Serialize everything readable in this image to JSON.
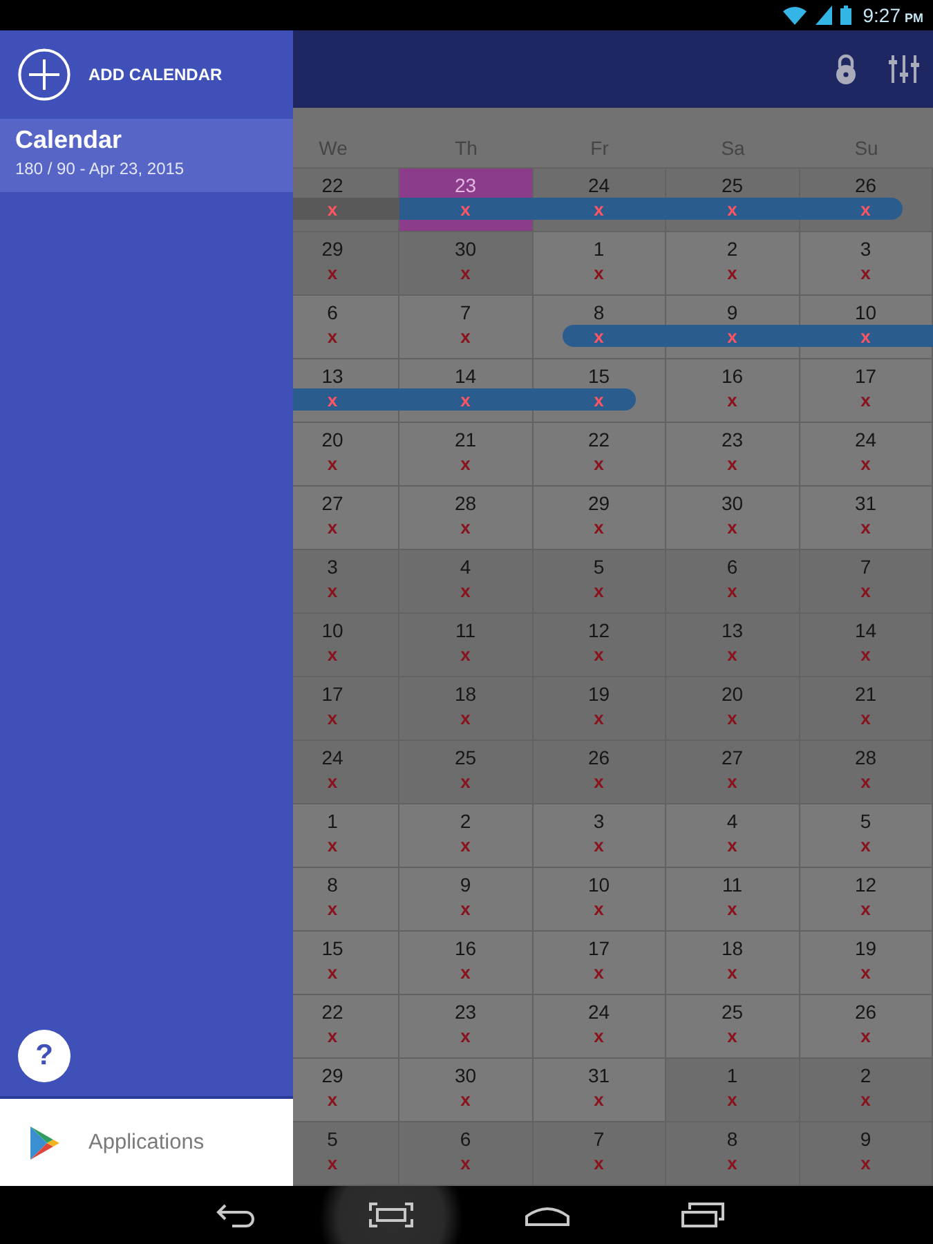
{
  "status_bar": {
    "time": "9:27",
    "meridiem": "PM"
  },
  "drawer": {
    "add_label": "ADD CALENDAR",
    "items": [
      {
        "title": "Calendar",
        "subtitle": "180 / 90 - Apr 23, 2015",
        "selected": true
      }
    ],
    "help_label": "?",
    "footer_label": "Applications"
  },
  "calendar": {
    "weekdays": [
      "We",
      "Th",
      "Fr",
      "Sa",
      "Su"
    ],
    "weeks": [
      [
        {
          "day": "22",
          "mark": "x",
          "shaded": true,
          "today": false,
          "band": {
            "starts": false,
            "ends": false,
            "color": "#595959"
          }
        },
        {
          "day": "23",
          "mark": "x",
          "shaded": true,
          "today": true,
          "band": {
            "starts": false,
            "ends": false,
            "color": "#2b5c8e"
          }
        },
        {
          "day": "24",
          "mark": "x",
          "shaded": true,
          "today": false,
          "band": {
            "starts": false,
            "ends": false,
            "color": "#2b5c8e"
          }
        },
        {
          "day": "25",
          "mark": "x",
          "shaded": true,
          "today": false,
          "band": {
            "starts": false,
            "ends": false,
            "color": "#2b5c8e"
          }
        },
        {
          "day": "26",
          "mark": "x",
          "shaded": true,
          "today": false,
          "band": {
            "starts": false,
            "ends": true,
            "color": "#2b5c8e"
          }
        }
      ],
      [
        {
          "day": "29",
          "mark": "x",
          "shaded": true,
          "today": false
        },
        {
          "day": "30",
          "mark": "x",
          "shaded": true,
          "today": false
        },
        {
          "day": "1",
          "mark": "x",
          "shaded": false,
          "today": false
        },
        {
          "day": "2",
          "mark": "x",
          "shaded": false,
          "today": false
        },
        {
          "day": "3",
          "mark": "x",
          "shaded": false,
          "today": false
        }
      ],
      [
        {
          "day": "6",
          "mark": "x",
          "shaded": false,
          "today": false
        },
        {
          "day": "7",
          "mark": "x",
          "shaded": false,
          "today": false
        },
        {
          "day": "8",
          "mark": "x",
          "shaded": false,
          "today": false,
          "band": {
            "starts": true,
            "ends": false,
            "color": "#2b5c8e"
          }
        },
        {
          "day": "9",
          "mark": "x",
          "shaded": false,
          "today": false,
          "band": {
            "starts": false,
            "ends": false,
            "color": "#2b5c8e"
          }
        },
        {
          "day": "10",
          "mark": "x",
          "shaded": false,
          "today": false,
          "band": {
            "starts": false,
            "ends": false,
            "color": "#2b5c8e"
          }
        }
      ],
      [
        {
          "day": "13",
          "mark": "x",
          "shaded": false,
          "today": false,
          "band": {
            "starts": false,
            "ends": false,
            "color": "#2b5c8e"
          }
        },
        {
          "day": "14",
          "mark": "x",
          "shaded": false,
          "today": false,
          "band": {
            "starts": false,
            "ends": false,
            "color": "#2b5c8e"
          }
        },
        {
          "day": "15",
          "mark": "x",
          "shaded": false,
          "today": false,
          "band": {
            "starts": false,
            "ends": true,
            "color": "#2b5c8e"
          }
        },
        {
          "day": "16",
          "mark": "x",
          "shaded": false,
          "today": false
        },
        {
          "day": "17",
          "mark": "x",
          "shaded": false,
          "today": false
        }
      ],
      [
        {
          "day": "20",
          "mark": "x",
          "shaded": false,
          "today": false
        },
        {
          "day": "21",
          "mark": "x",
          "shaded": false,
          "today": false
        },
        {
          "day": "22",
          "mark": "x",
          "shaded": false,
          "today": false
        },
        {
          "day": "23",
          "mark": "x",
          "shaded": false,
          "today": false
        },
        {
          "day": "24",
          "mark": "x",
          "shaded": false,
          "today": false
        }
      ],
      [
        {
          "day": "27",
          "mark": "x",
          "shaded": false,
          "today": false
        },
        {
          "day": "28",
          "mark": "x",
          "shaded": false,
          "today": false
        },
        {
          "day": "29",
          "mark": "x",
          "shaded": false,
          "today": false
        },
        {
          "day": "30",
          "mark": "x",
          "shaded": false,
          "today": false
        },
        {
          "day": "31",
          "mark": "x",
          "shaded": false,
          "today": false
        }
      ],
      [
        {
          "day": "3",
          "mark": "x",
          "shaded": true,
          "today": false
        },
        {
          "day": "4",
          "mark": "x",
          "shaded": true,
          "today": false
        },
        {
          "day": "5",
          "mark": "x",
          "shaded": true,
          "today": false
        },
        {
          "day": "6",
          "mark": "x",
          "shaded": true,
          "today": false
        },
        {
          "day": "7",
          "mark": "x",
          "shaded": true,
          "today": false
        }
      ],
      [
        {
          "day": "10",
          "mark": "x",
          "shaded": true,
          "today": false
        },
        {
          "day": "11",
          "mark": "x",
          "shaded": true,
          "today": false
        },
        {
          "day": "12",
          "mark": "x",
          "shaded": true,
          "today": false
        },
        {
          "day": "13",
          "mark": "x",
          "shaded": true,
          "today": false
        },
        {
          "day": "14",
          "mark": "x",
          "shaded": true,
          "today": false
        }
      ],
      [
        {
          "day": "17",
          "mark": "x",
          "shaded": true,
          "today": false
        },
        {
          "day": "18",
          "mark": "x",
          "shaded": true,
          "today": false
        },
        {
          "day": "19",
          "mark": "x",
          "shaded": true,
          "today": false
        },
        {
          "day": "20",
          "mark": "x",
          "shaded": true,
          "today": false
        },
        {
          "day": "21",
          "mark": "x",
          "shaded": true,
          "today": false
        }
      ],
      [
        {
          "day": "24",
          "mark": "x",
          "shaded": true,
          "today": false
        },
        {
          "day": "25",
          "mark": "x",
          "shaded": true,
          "today": false
        },
        {
          "day": "26",
          "mark": "x",
          "shaded": true,
          "today": false
        },
        {
          "day": "27",
          "mark": "x",
          "shaded": true,
          "today": false
        },
        {
          "day": "28",
          "mark": "x",
          "shaded": true,
          "today": false
        }
      ],
      [
        {
          "day": "1",
          "mark": "x",
          "shaded": false,
          "today": false
        },
        {
          "day": "2",
          "mark": "x",
          "shaded": false,
          "today": false
        },
        {
          "day": "3",
          "mark": "x",
          "shaded": false,
          "today": false
        },
        {
          "day": "4",
          "mark": "x",
          "shaded": false,
          "today": false
        },
        {
          "day": "5",
          "mark": "x",
          "shaded": false,
          "today": false
        }
      ],
      [
        {
          "day": "8",
          "mark": "x",
          "shaded": false,
          "today": false
        },
        {
          "day": "9",
          "mark": "x",
          "shaded": false,
          "today": false
        },
        {
          "day": "10",
          "mark": "x",
          "shaded": false,
          "today": false
        },
        {
          "day": "11",
          "mark": "x",
          "shaded": false,
          "today": false
        },
        {
          "day": "12",
          "mark": "x",
          "shaded": false,
          "today": false
        }
      ],
      [
        {
          "day": "15",
          "mark": "x",
          "shaded": false,
          "today": false
        },
        {
          "day": "16",
          "mark": "x",
          "shaded": false,
          "today": false
        },
        {
          "day": "17",
          "mark": "x",
          "shaded": false,
          "today": false
        },
        {
          "day": "18",
          "mark": "x",
          "shaded": false,
          "today": false
        },
        {
          "day": "19",
          "mark": "x",
          "shaded": false,
          "today": false
        }
      ],
      [
        {
          "day": "22",
          "mark": "x",
          "shaded": false,
          "today": false
        },
        {
          "day": "23",
          "mark": "x",
          "shaded": false,
          "today": false
        },
        {
          "day": "24",
          "mark": "x",
          "shaded": false,
          "today": false
        },
        {
          "day": "25",
          "mark": "x",
          "shaded": false,
          "today": false
        },
        {
          "day": "26",
          "mark": "x",
          "shaded": false,
          "today": false
        }
      ],
      [
        {
          "day": "29",
          "mark": "x",
          "shaded": false,
          "today": false
        },
        {
          "day": "30",
          "mark": "x",
          "shaded": false,
          "today": false
        },
        {
          "day": "31",
          "mark": "x",
          "shaded": false,
          "today": false
        },
        {
          "day": "1",
          "mark": "x",
          "shaded": true,
          "today": false
        },
        {
          "day": "2",
          "mark": "x",
          "shaded": true,
          "today": false
        }
      ],
      [
        {
          "day": "5",
          "mark": "x",
          "shaded": true,
          "today": false
        },
        {
          "day": "6",
          "mark": "x",
          "shaded": true,
          "today": false
        },
        {
          "day": "7",
          "mark": "x",
          "shaded": true,
          "today": false
        },
        {
          "day": "8",
          "mark": "x",
          "shaded": true,
          "today": false
        },
        {
          "day": "9",
          "mark": "x",
          "shaded": true,
          "today": false
        }
      ]
    ]
  },
  "nav_bar": {
    "buttons": [
      {
        "kind": "back",
        "pressed": false
      },
      {
        "kind": "frame",
        "pressed": true
      },
      {
        "kind": "home",
        "pressed": false
      },
      {
        "kind": "recents",
        "pressed": false
      }
    ]
  }
}
